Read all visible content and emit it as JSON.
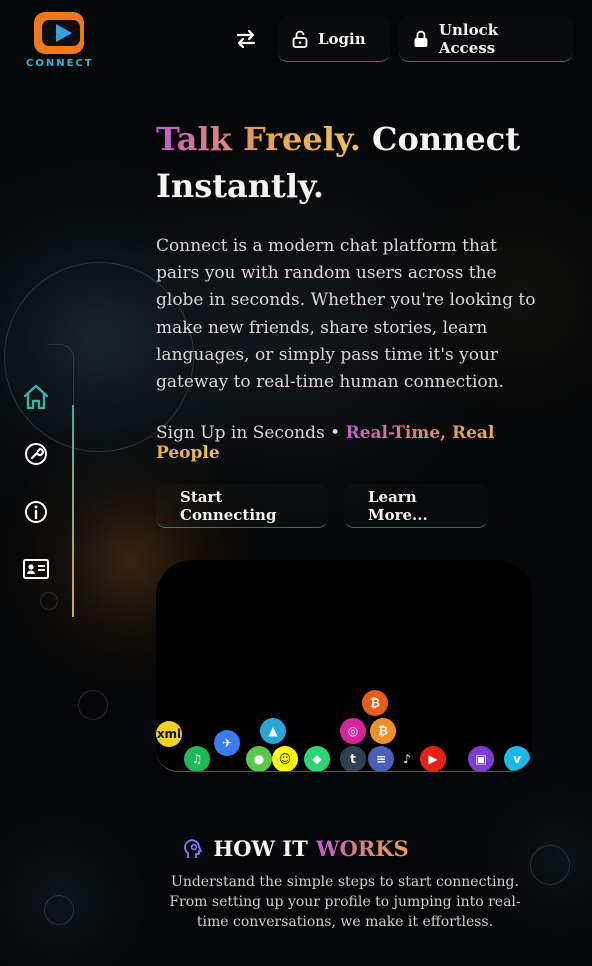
{
  "brand": {
    "name": "CONNECT",
    "logo_colors": {
      "frame": "#f07a1a",
      "play": "#3b9fe0"
    }
  },
  "header": {
    "swap_icon": "swap-arrows-icon",
    "login_label": "Login",
    "unlock_label": "Unlock Access"
  },
  "sidenav": {
    "items": [
      {
        "name": "home",
        "icon": "home-icon",
        "active": true
      },
      {
        "name": "tools",
        "icon": "wrench-icon"
      },
      {
        "name": "info",
        "icon": "info-icon"
      },
      {
        "name": "contact",
        "icon": "contact-card-icon"
      }
    ]
  },
  "hero": {
    "title_highlight": "Talk Freely.",
    "title_rest": " Connect Instantly.",
    "description": "Connect is a modern chat platform that pairs you with random users across the globe in seconds. Whether you're looking to make new friends, share stories, learn languages, or simply pass time it's your gateway to real-time human connection.",
    "tagline_plain": "Sign Up in Seconds • ",
    "tagline_highlight": "Real-Time, Real People",
    "cta_primary": "Start Connecting",
    "cta_secondary": "Learn More..."
  },
  "apps": [
    {
      "name": "xml-icon",
      "label": "xml",
      "color": "#f2d21b"
    },
    {
      "name": "spotify-icon",
      "label": "♫",
      "color": "#1db954"
    },
    {
      "name": "bluesky-icon",
      "label": "✈",
      "color": "#3b7bf0"
    },
    {
      "name": "telegram-icon",
      "label": "▲",
      "color": "#2aa3d6"
    },
    {
      "name": "wechat-icon",
      "label": "●",
      "color": "#5ac84a"
    },
    {
      "name": "snapchat-icon",
      "label": "☺",
      "color": "#fffc00"
    },
    {
      "name": "discord-icon",
      "label": "◆",
      "color": "#2ed573"
    },
    {
      "name": "instagram-icon",
      "label": "◎",
      "color": "#d6249f"
    },
    {
      "name": "bitcoin-icon",
      "label": "₿",
      "color": "#e85d1a"
    },
    {
      "name": "bitcoin-icon",
      "label": "₿",
      "color": "#f0902a"
    },
    {
      "name": "tumblr-icon",
      "label": "t",
      "color": "#2f4055"
    },
    {
      "name": "stack-icon",
      "label": "≡",
      "color": "#4a5fb5"
    },
    {
      "name": "tiktok-icon",
      "label": "♪",
      "color": "#000000"
    },
    {
      "name": "youtube-icon",
      "label": "▶",
      "color": "#e62117"
    },
    {
      "name": "forum-icon",
      "label": "▣",
      "color": "#7a3fd0"
    },
    {
      "name": "vimeo-icon",
      "label": "v",
      "color": "#1ab7ea"
    }
  ],
  "how_it_works": {
    "heading_plain": "HOW IT ",
    "heading_highlight": "WORKS",
    "description": "Understand the simple steps to start connecting. From setting up your profile to jumping into real-time conversations, we make it effortless."
  },
  "colors": {
    "accent_teal": "#3bb0a0",
    "accent_gold": "#e8a34a",
    "accent_purple": "#c35bd0"
  }
}
